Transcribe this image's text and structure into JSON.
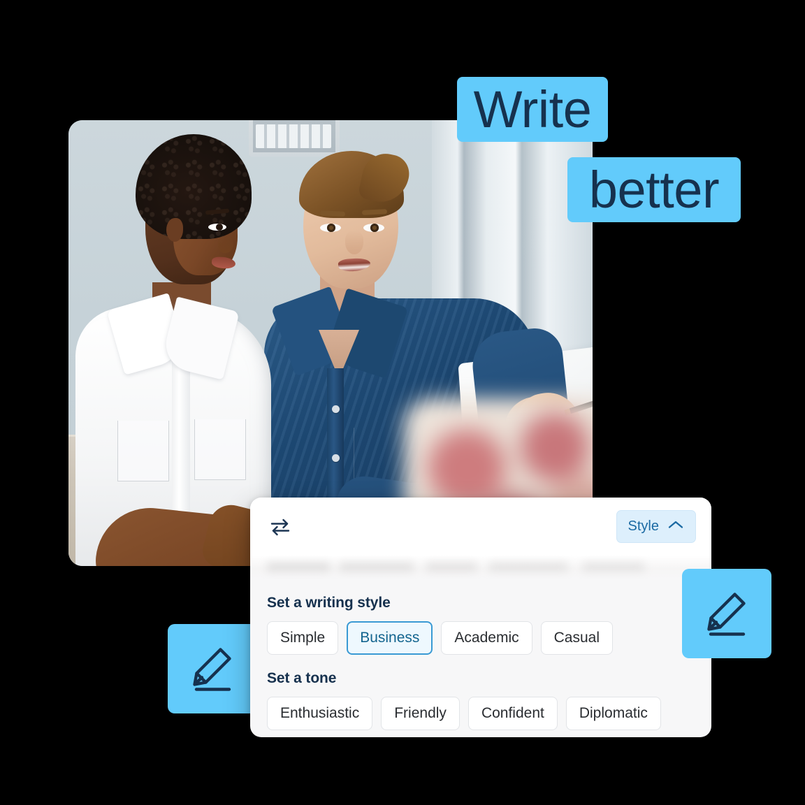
{
  "theme": {
    "highlight_blue": "#62cbfb",
    "ink_navy": "#16314e",
    "accent_blue": "#3a9ad4",
    "card_bg": "#f7f7f8",
    "page_bg": "#000000"
  },
  "headline": {
    "line1": "Write",
    "line2": "better"
  },
  "photo": {
    "alt": "Two colleagues at a desk looking at a laptop"
  },
  "badges": {
    "left_icon": "pencil-write-icon",
    "right_icon": "pencil-write-icon"
  },
  "card": {
    "toolbar": {
      "swap_icon": "swap-arrows-icon",
      "style_button_label": "Style",
      "style_button_icon": "chevron-up-icon"
    },
    "writing_style": {
      "title": "Set a writing style",
      "options": [
        {
          "label": "Simple",
          "selected": false
        },
        {
          "label": "Business",
          "selected": true
        },
        {
          "label": "Academic",
          "selected": false
        },
        {
          "label": "Casual",
          "selected": false
        }
      ]
    },
    "tone": {
      "title": "Set a tone",
      "options": [
        {
          "label": "Enthusiastic",
          "selected": false
        },
        {
          "label": "Friendly",
          "selected": false
        },
        {
          "label": "Confident",
          "selected": false
        },
        {
          "label": "Diplomatic",
          "selected": false
        }
      ]
    }
  }
}
